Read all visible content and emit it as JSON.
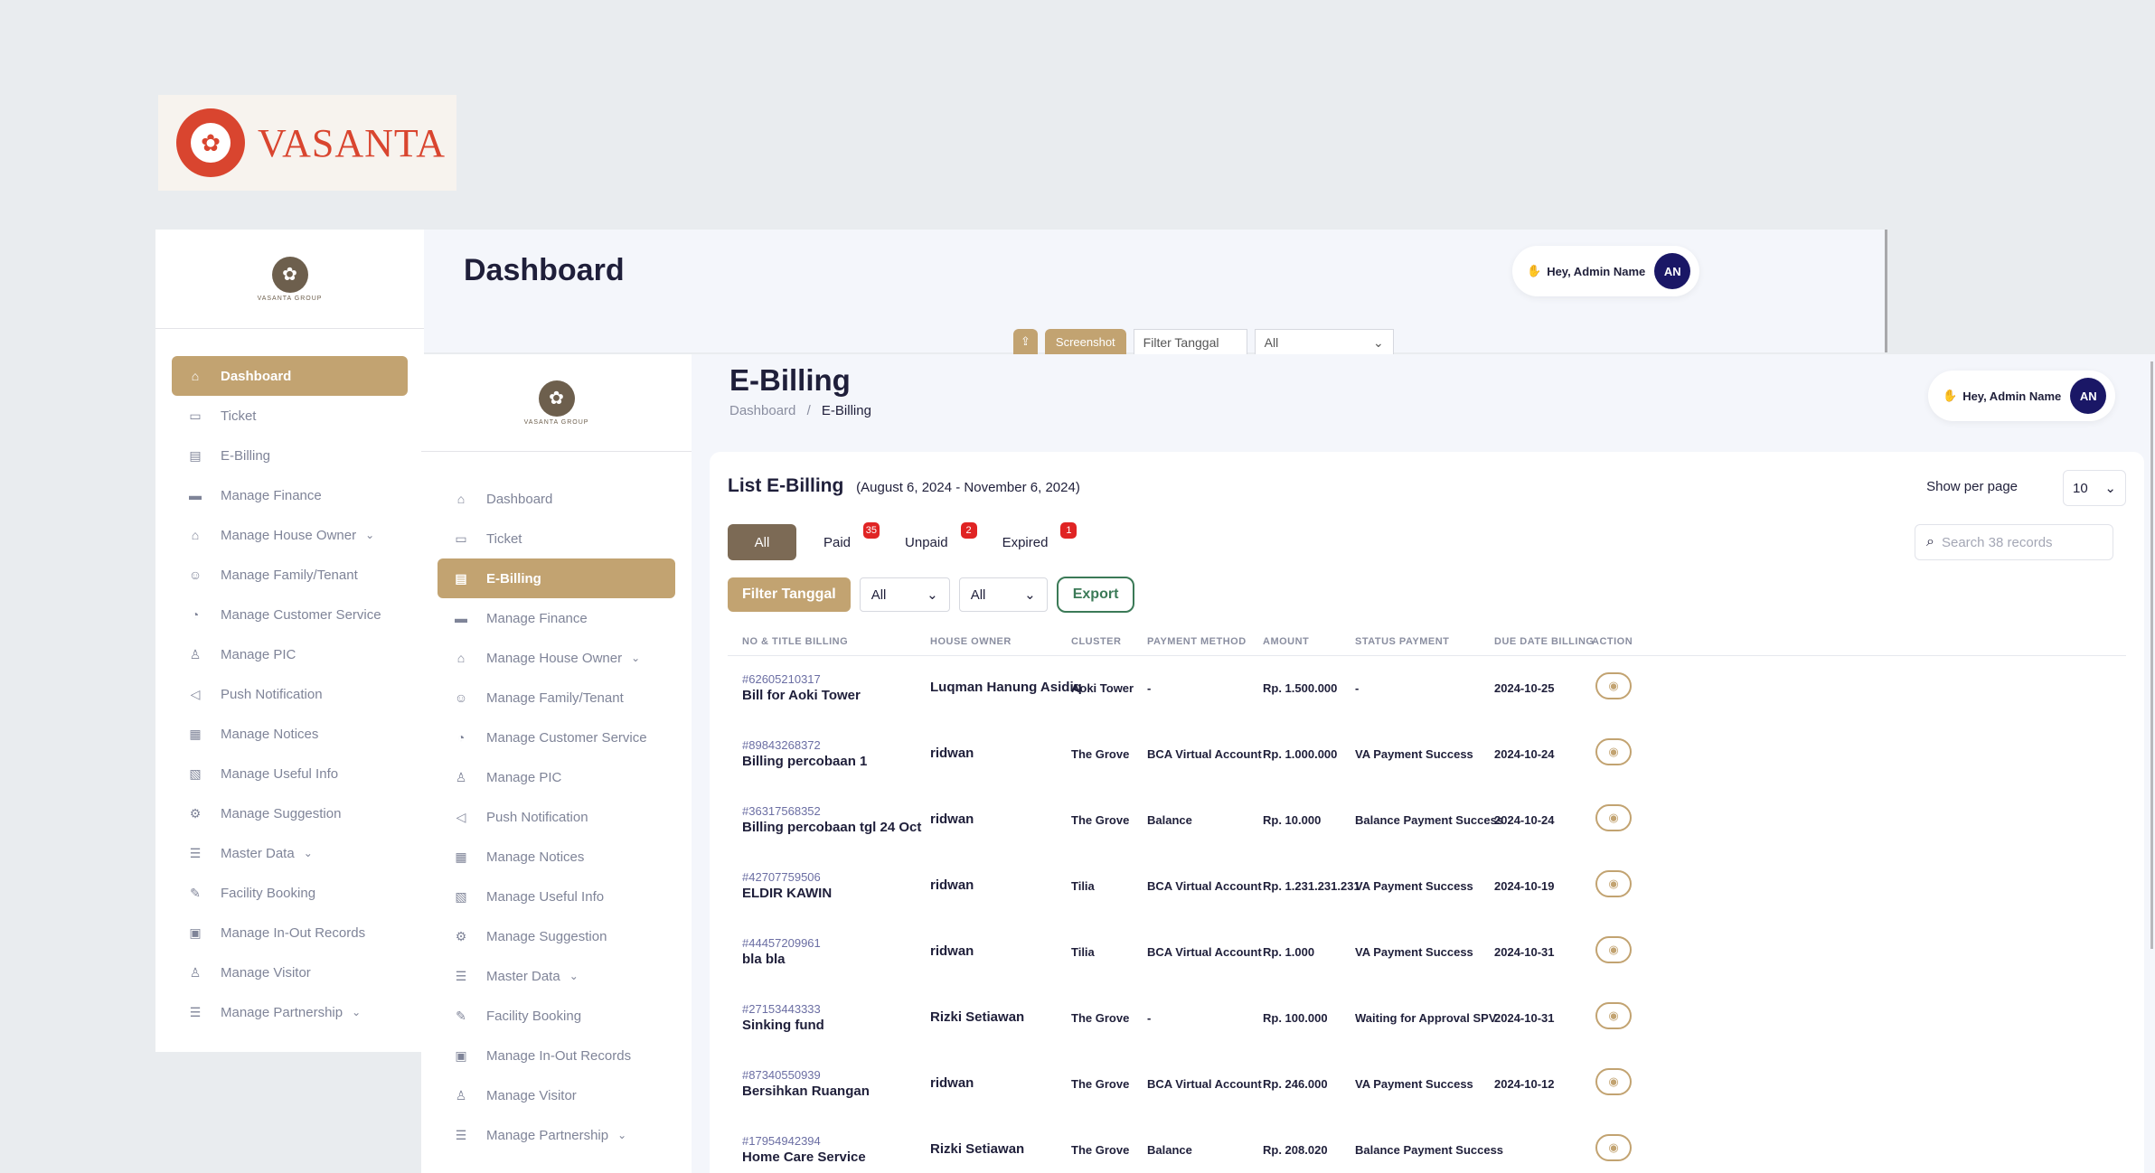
{
  "brand": {
    "name": "VASANTA",
    "mark_icon": "flower-icon"
  },
  "sidebar_logo_caption": "VASANTA GROUP",
  "back_window": {
    "title": "Dashboard",
    "greeting": "Hey, Admin Name",
    "avatar": "AN",
    "toolbar": {
      "screenshot_label": "Screenshot",
      "date_placeholder": "Filter Tanggal",
      "select_value": "All"
    },
    "sidebar": [
      {
        "label": "Dashboard",
        "icon": "home-icon",
        "active": true
      },
      {
        "label": "Ticket",
        "icon": "ticket-icon"
      },
      {
        "label": "E-Billing",
        "icon": "document-icon"
      },
      {
        "label": "Manage Finance",
        "icon": "finance-icon"
      },
      {
        "label": "Manage House Owner",
        "icon": "house-icon",
        "expandable": true
      },
      {
        "label": "Manage Family/Tenant",
        "icon": "users-icon"
      },
      {
        "label": "Manage Customer Service",
        "icon": "headset-icon"
      },
      {
        "label": "Manage PIC",
        "icon": "user-gear-icon"
      },
      {
        "label": "Push Notification",
        "icon": "megaphone-icon"
      },
      {
        "label": "Manage Notices",
        "icon": "notice-icon"
      },
      {
        "label": "Manage Useful Info",
        "icon": "info-icon"
      },
      {
        "label": "Manage Suggestion",
        "icon": "gear-icon"
      },
      {
        "label": "Master Data",
        "icon": "list-icon",
        "expandable": true
      },
      {
        "label": "Facility Booking",
        "icon": "booking-icon"
      },
      {
        "label": "Manage In-Out Records",
        "icon": "car-icon"
      },
      {
        "label": "Manage Visitor",
        "icon": "visitor-icon"
      },
      {
        "label": "Manage Partnership",
        "icon": "list-icon",
        "expandable": true
      }
    ]
  },
  "front_window": {
    "title": "E-Billing",
    "breadcrumb": [
      "Dashboard",
      "E-Billing"
    ],
    "greeting": "Hey, Admin Name",
    "avatar": "AN",
    "sidebar": [
      {
        "label": "Dashboard",
        "icon": "home-icon"
      },
      {
        "label": "Ticket",
        "icon": "ticket-icon"
      },
      {
        "label": "E-Billing",
        "icon": "document-icon",
        "active": true
      },
      {
        "label": "Manage Finance",
        "icon": "finance-icon"
      },
      {
        "label": "Manage House Owner",
        "icon": "house-icon",
        "expandable": true
      },
      {
        "label": "Manage Family/Tenant",
        "icon": "users-icon"
      },
      {
        "label": "Manage Customer Service",
        "icon": "headset-icon"
      },
      {
        "label": "Manage PIC",
        "icon": "user-gear-icon"
      },
      {
        "label": "Push Notification",
        "icon": "megaphone-icon"
      },
      {
        "label": "Manage Notices",
        "icon": "notice-icon"
      },
      {
        "label": "Manage Useful Info",
        "icon": "info-icon"
      },
      {
        "label": "Manage Suggestion",
        "icon": "gear-icon"
      },
      {
        "label": "Master Data",
        "icon": "list-icon",
        "expandable": true
      },
      {
        "label": "Facility Booking",
        "icon": "booking-icon"
      },
      {
        "label": "Manage In-Out Records",
        "icon": "car-icon"
      },
      {
        "label": "Manage Visitor",
        "icon": "visitor-icon"
      },
      {
        "label": "Manage Partnership",
        "icon": "list-icon",
        "expandable": true
      }
    ],
    "list": {
      "title": "List E-Billing",
      "range": "(August 6, 2024 - November 6, 2024)",
      "show_per_page_label": "Show per page",
      "per_page_value": "10",
      "search_placeholder": "Search 38 records",
      "tabs": [
        {
          "label": "All",
          "active": true
        },
        {
          "label": "Paid",
          "badge": "35"
        },
        {
          "label": "Unpaid",
          "badge": "2"
        },
        {
          "label": "Expired",
          "badge": "1"
        }
      ],
      "filter_button": "Filter Tanggal",
      "filter_select_1": "All",
      "filter_select_2": "All",
      "export_button": "Export",
      "columns": [
        "NO & TITLE BILLING",
        "HOUSE OWNER",
        "CLUSTER",
        "PAYMENT METHOD",
        "AMOUNT",
        "STATUS PAYMENT",
        "DUE DATE BILLING",
        "ACTION"
      ],
      "rows": [
        {
          "no": "#62605210317",
          "title": "Bill for Aoki Tower",
          "owner": "Luqman Hanung Asidiq",
          "cluster": "Aoki Tower",
          "method": "-",
          "amount": "Rp. 1.500.000",
          "status": "-",
          "due": "2024-10-25"
        },
        {
          "no": "#89843268372",
          "title": "Billing percobaan 1",
          "owner": "ridwan",
          "cluster": "The Grove",
          "method": "BCA Virtual Account",
          "amount": "Rp. 1.000.000",
          "status": "VA Payment Success",
          "due": "2024-10-24"
        },
        {
          "no": "#36317568352",
          "title": "Billing percobaan tgl 24 Oct",
          "owner": "ridwan",
          "cluster": "The Grove",
          "method": "Balance",
          "amount": "Rp. 10.000",
          "status": "Balance Payment Success",
          "due": "2024-10-24"
        },
        {
          "no": "#42707759506",
          "title": "ELDIR KAWIN",
          "owner": "ridwan",
          "cluster": "Tilia",
          "method": "BCA Virtual Account",
          "amount": "Rp. 1.231.231.231",
          "status": "VA Payment Success",
          "due": "2024-10-19"
        },
        {
          "no": "#44457209961",
          "title": "bla bla",
          "owner": "ridwan",
          "cluster": "Tilia",
          "method": "BCA Virtual Account",
          "amount": "Rp. 1.000",
          "status": "VA Payment Success",
          "due": "2024-10-31"
        },
        {
          "no": "#27153443333",
          "title": "Sinking fund",
          "owner": "Rizki Setiawan",
          "cluster": "The Grove",
          "method": "-",
          "amount": "Rp. 100.000",
          "status": "Waiting for Approval SPV",
          "due": "2024-10-31"
        },
        {
          "no": "#87340550939",
          "title": "Bersihkan Ruangan",
          "owner": "ridwan",
          "cluster": "The Grove",
          "method": "BCA Virtual Account",
          "amount": "Rp. 246.000",
          "status": "VA Payment Success",
          "due": "2024-10-12"
        },
        {
          "no": "#17954942394",
          "title": "Home Care Service",
          "owner": "Rizki Setiawan",
          "cluster": "The Grove",
          "method": "Balance",
          "amount": "Rp. 208.020",
          "status": "Balance Payment Success",
          "due": ""
        }
      ]
    }
  },
  "colors": {
    "accent": "#c2a371",
    "tab_active": "#7c6a55",
    "badge": "#e02424",
    "export": "#3b7a57",
    "avatar": "#1a1766",
    "brand": "#d9452f"
  }
}
